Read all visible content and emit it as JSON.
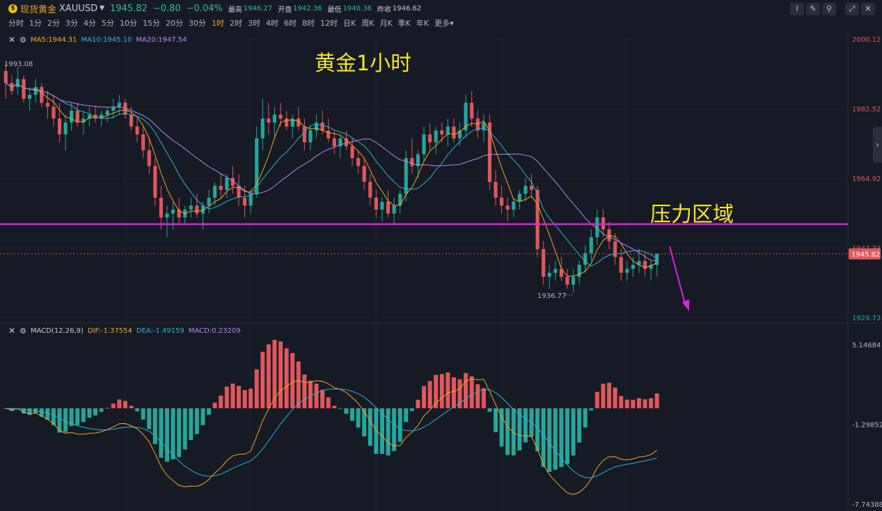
{
  "header": {
    "coin_glyph": "$",
    "symbol_name": "现货黄金",
    "symbol_code": "XAUUSD",
    "price": "1945.82",
    "change": "−0.80",
    "change_pct": "−0.04%",
    "high_label": "最高",
    "high": "1946.27",
    "open_label": "开盘",
    "open": "1942.36",
    "low_label": "最低",
    "low": "1940.36",
    "prev_label": "昨收",
    "prev": "1946.62"
  },
  "timeframes": [
    "分时",
    "1分",
    "2分",
    "3分",
    "4分",
    "5分",
    "10分",
    "15分",
    "20分",
    "30分",
    "1时",
    "2时",
    "3时",
    "4时",
    "6时",
    "8时",
    "12时",
    "日K",
    "周K",
    "月K",
    "季K",
    "年K",
    "更多"
  ],
  "active_timeframe": "1时",
  "toolbar": {
    "icons": [
      "chart-type-icon",
      "draw-icon",
      "indicator-icon",
      "fullscreen-icon",
      "close-icon"
    ]
  },
  "main_legend": {
    "ma5": "MA5:1944.31",
    "ma10": "MA10:1945.10",
    "ma20": "MA20:1947.54"
  },
  "macd_legend": {
    "name": "MACD(12,26,9)",
    "dif": "DIF:-1.37554",
    "dea": "DEA:-1.49159",
    "macd": "MACD:0.23209"
  },
  "annotations": {
    "title": "黄金1小时",
    "zone_label": "压力区域",
    "high_marker": "1993.08",
    "low_marker": "1936.77",
    "current_price_tag": "1945.82",
    "hidden_tick": "1947.33"
  },
  "colors": {
    "bg": "#161a25",
    "up": "#26a69a",
    "down": "#e0575b",
    "ma5": "#f5a623",
    "ma10": "#2ab7d6",
    "ma20": "#b38af0",
    "zone_line": "#e020e0",
    "arrow": "#e020e0",
    "title": "#f5e62a"
  },
  "chart_data": [
    {
      "type": "candlestick",
      "title": "黄金1小时",
      "ylim": [
        1929.73,
        2000.12
      ],
      "y_ticks": [
        "2000.12",
        "1982.52",
        "1964.92",
        "1947.33",
        "1929.73"
      ],
      "resistance_level": 1953.3,
      "candles_ohlc": [
        [
          1992,
          1994,
          1985,
          1989
        ],
        [
          1989,
          1991,
          1986,
          1987
        ],
        [
          1988,
          1993,
          1986,
          1990
        ],
        [
          1990,
          1991,
          1984,
          1985
        ],
        [
          1985,
          1988,
          1982,
          1986
        ],
        [
          1986,
          1990,
          1984,
          1988
        ],
        [
          1988,
          1989,
          1983,
          1984
        ],
        [
          1984,
          1987,
          1980,
          1983
        ],
        [
          1983,
          1986,
          1978,
          1980
        ],
        [
          1980,
          1984,
          1974,
          1976
        ],
        [
          1976,
          1981,
          1972,
          1979
        ],
        [
          1979,
          1984,
          1977,
          1982
        ],
        [
          1982,
          1984,
          1978,
          1979
        ],
        [
          1979,
          1982,
          1976,
          1980
        ],
        [
          1980,
          1983,
          1978,
          1981
        ],
        [
          1981,
          1983,
          1979,
          1980
        ],
        [
          1980,
          1982,
          1978,
          1981
        ],
        [
          1981,
          1983,
          1979,
          1982
        ],
        [
          1982,
          1985,
          1980,
          1983
        ],
        [
          1983,
          1986,
          1981,
          1984
        ],
        [
          1984,
          1985,
          1980,
          1981
        ],
        [
          1981,
          1983,
          1977,
          1978
        ],
        [
          1978,
          1980,
          1974,
          1976
        ],
        [
          1976,
          1978,
          1970,
          1972
        ],
        [
          1972,
          1975,
          1966,
          1968
        ],
        [
          1968,
          1970,
          1958,
          1960
        ],
        [
          1960,
          1963,
          1952,
          1955
        ],
        [
          1955,
          1958,
          1950,
          1956
        ],
        [
          1956,
          1959,
          1952,
          1957
        ],
        [
          1957,
          1960,
          1953,
          1955
        ],
        [
          1955,
          1958,
          1953,
          1957
        ],
        [
          1957,
          1960,
          1955,
          1958
        ],
        [
          1958,
          1961,
          1955,
          1956
        ],
        [
          1956,
          1959,
          1952,
          1958
        ],
        [
          1958,
          1962,
          1956,
          1960
        ],
        [
          1960,
          1964,
          1958,
          1963
        ],
        [
          1963,
          1966,
          1960,
          1962
        ],
        [
          1962,
          1966,
          1960,
          1965
        ],
        [
          1965,
          1968,
          1961,
          1963
        ],
        [
          1963,
          1966,
          1958,
          1960
        ],
        [
          1960,
          1963,
          1955,
          1958
        ],
        [
          1958,
          1962,
          1956,
          1961
        ],
        [
          1961,
          1978,
          1960,
          1975
        ],
        [
          1975,
          1985,
          1972,
          1980
        ],
        [
          1980,
          1984,
          1976,
          1979
        ],
        [
          1979,
          1983,
          1975,
          1981
        ],
        [
          1981,
          1984,
          1978,
          1980
        ],
        [
          1980,
          1982,
          1977,
          1978
        ],
        [
          1978,
          1981,
          1975,
          1980
        ],
        [
          1980,
          1983,
          1977,
          1978
        ],
        [
          1978,
          1980,
          1972,
          1974
        ],
        [
          1974,
          1978,
          1972,
          1977
        ],
        [
          1977,
          1981,
          1975,
          1979
        ],
        [
          1979,
          1982,
          1976,
          1977
        ],
        [
          1977,
          1980,
          1974,
          1975
        ],
        [
          1975,
          1977,
          1971,
          1973
        ],
        [
          1973,
          1976,
          1970,
          1975
        ],
        [
          1975,
          1977,
          1972,
          1973
        ],
        [
          1973,
          1975,
          1968,
          1970
        ],
        [
          1970,
          1972,
          1966,
          1968
        ],
        [
          1968,
          1970,
          1962,
          1964
        ],
        [
          1964,
          1966,
          1958,
          1960
        ],
        [
          1960,
          1962,
          1955,
          1957
        ],
        [
          1957,
          1960,
          1954,
          1959
        ],
        [
          1959,
          1962,
          1955,
          1956
        ],
        [
          1956,
          1960,
          1953,
          1958
        ],
        [
          1958,
          1962,
          1956,
          1961
        ],
        [
          1961,
          1972,
          1959,
          1970
        ],
        [
          1970,
          1975,
          1966,
          1968
        ],
        [
          1968,
          1972,
          1965,
          1971
        ],
        [
          1971,
          1978,
          1969,
          1976
        ],
        [
          1976,
          1979,
          1972,
          1974
        ],
        [
          1974,
          1978,
          1971,
          1977
        ],
        [
          1977,
          1979,
          1974,
          1976
        ],
        [
          1976,
          1980,
          1973,
          1978
        ],
        [
          1978,
          1980,
          1974,
          1975
        ],
        [
          1975,
          1979,
          1973,
          1977
        ],
        [
          1977,
          1986,
          1975,
          1984
        ],
        [
          1984,
          1987,
          1978,
          1980
        ],
        [
          1980,
          1982,
          1975,
          1977
        ],
        [
          1977,
          1981,
          1974,
          1979
        ],
        [
          1979,
          1981,
          1962,
          1964
        ],
        [
          1964,
          1967,
          1958,
          1960
        ],
        [
          1960,
          1963,
          1956,
          1958
        ],
        [
          1958,
          1960,
          1954,
          1957
        ],
        [
          1957,
          1960,
          1955,
          1959
        ],
        [
          1959,
          1962,
          1957,
          1961
        ],
        [
          1961,
          1965,
          1959,
          1963
        ],
        [
          1963,
          1966,
          1960,
          1962
        ],
        [
          1962,
          1963,
          1945,
          1947
        ],
        [
          1947,
          1949,
          1938,
          1940
        ],
        [
          1940,
          1943,
          1937,
          1941
        ],
        [
          1941,
          1944,
          1939,
          1942
        ],
        [
          1942,
          1945,
          1939,
          1940
        ],
        [
          1940,
          1942,
          1937,
          1938
        ],
        [
          1938,
          1942,
          1936,
          1940
        ],
        [
          1940,
          1944,
          1938,
          1943
        ],
        [
          1943,
          1948,
          1941,
          1946
        ],
        [
          1946,
          1952,
          1944,
          1950
        ],
        [
          1950,
          1957,
          1948,
          1955
        ],
        [
          1955,
          1957,
          1950,
          1952
        ],
        [
          1952,
          1954,
          1947,
          1949
        ],
        [
          1949,
          1951,
          1943,
          1945
        ],
        [
          1945,
          1947,
          1939,
          1941
        ],
        [
          1941,
          1944,
          1939,
          1942
        ],
        [
          1942,
          1945,
          1940,
          1943
        ],
        [
          1943,
          1947,
          1941,
          1944
        ],
        [
          1944,
          1946,
          1940,
          1942
        ],
        [
          1942,
          1944,
          1939,
          1943
        ],
        [
          1943,
          1946,
          1940,
          1945.8
        ]
      ],
      "ma_series": [
        {
          "name": "MA5",
          "value": 1944.31
        },
        {
          "name": "MA10",
          "value": 1945.1
        },
        {
          "name": "MA20",
          "value": 1947.54
        }
      ]
    },
    {
      "type": "bar+line",
      "title": "MACD(12,26,9)",
      "ylim": [
        -7.74388,
        5.14684
      ],
      "y_ticks": [
        "5.14684",
        "-1.29852",
        "-7.74388"
      ],
      "series": [
        {
          "name": "DIF",
          "last": -1.37554
        },
        {
          "name": "DEA",
          "last": -1.49159
        },
        {
          "name": "MACD",
          "last": 0.23209
        }
      ]
    }
  ]
}
